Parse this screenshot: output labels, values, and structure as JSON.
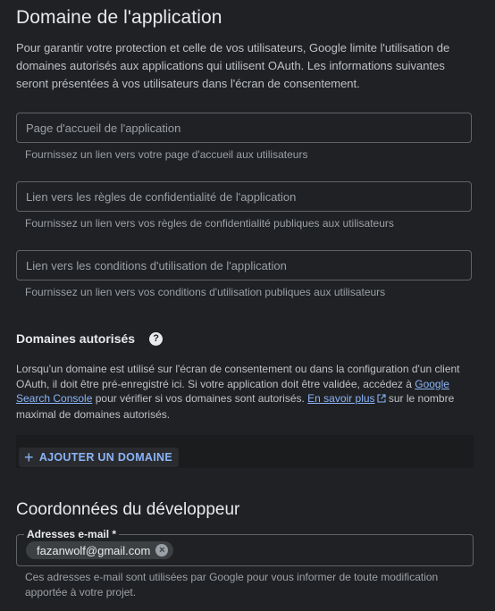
{
  "app_domain": {
    "title": "Domaine de l'application",
    "intro": "Pour garantir votre protection et celle de vos utilisateurs, Google limite l'utilisation de domaines autorisés aux applications qui utilisent OAuth. Les informations suivantes seront présentées à vos utilisateurs dans l'écran de consentement.",
    "fields": [
      {
        "placeholder": "Page d'accueil de l'application",
        "hint": "Fournissez un lien vers votre page d'accueil aux utilisateurs"
      },
      {
        "placeholder": "Lien vers les règles de confidentialité de l'application",
        "hint": "Fournissez un lien vers vos règles de confidentialité publiques aux utilisateurs"
      },
      {
        "placeholder": "Lien vers les conditions d'utilisation de l'application",
        "hint": "Fournissez un lien vers vos conditions d'utilisation publiques aux utilisateurs"
      }
    ]
  },
  "authorized_domains": {
    "title": "Domaines autorisés",
    "help_icon": "help-circle-icon",
    "desc_part1": "Lorsqu'un domaine est utilisé sur l'écran de consentement ou dans la configuration d'un client OAuth, il doit être pré-enregistré ici. Si votre application doit être validée, accédez à ",
    "search_console_link": "Google Search Console",
    "desc_part2": " pour vérifier si vos domaines sont autorisés. ",
    "learn_more_link": "En savoir plus",
    "desc_part3": " sur le nombre maximal de domaines autorisés.",
    "add_button": "AJOUTER UN DOMAINE"
  },
  "developer": {
    "title": "Coordonnées du développeur",
    "email_label": "Adresses e-mail *",
    "email_chip": "fazanwolf@gmail.com",
    "hint": "Ces adresses e-mail sont utilisées par Google pour vous informer de toute modification apportée à votre projet."
  },
  "colors": {
    "background": "#202124",
    "link": "#8ab4f8",
    "border": "#5f6368"
  }
}
